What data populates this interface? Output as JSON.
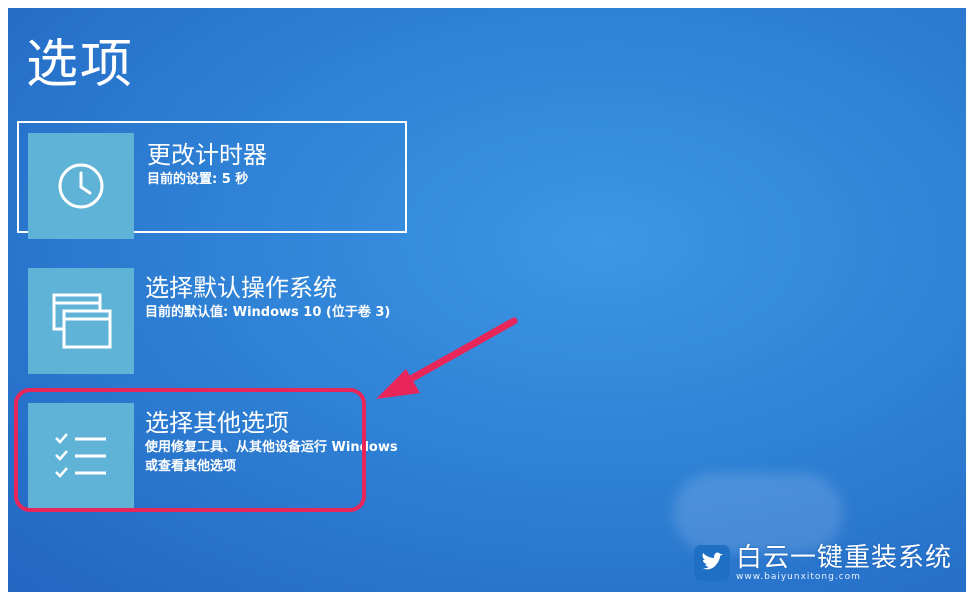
{
  "page": {
    "title": "选项"
  },
  "options": [
    {
      "title": "更改计时器",
      "subtitle": "目前的设置: 5 秒",
      "icon": "clock-icon",
      "selected": true
    },
    {
      "title": "选择默认操作系统",
      "subtitle": "目前的默认值: Windows 10 (位于卷 3)",
      "icon": "windows-stack-icon",
      "selected": false
    },
    {
      "title": "选择其他选项",
      "subtitle": "使用修复工具、从其他设备运行 Windows 或查看其他选项",
      "icon": "checklist-icon",
      "selected": false
    }
  ],
  "annotation": {
    "highlight_color": "#e8265a",
    "arrow_color": "#e8265a"
  },
  "watermark": {
    "text": "白云一键重装系统",
    "url": "www.baiyunxitong.com",
    "icon": "twitter-bird-icon"
  },
  "colors": {
    "background": "#2f82d6",
    "tile": "#5fb3d6",
    "text": "#ffffff"
  }
}
